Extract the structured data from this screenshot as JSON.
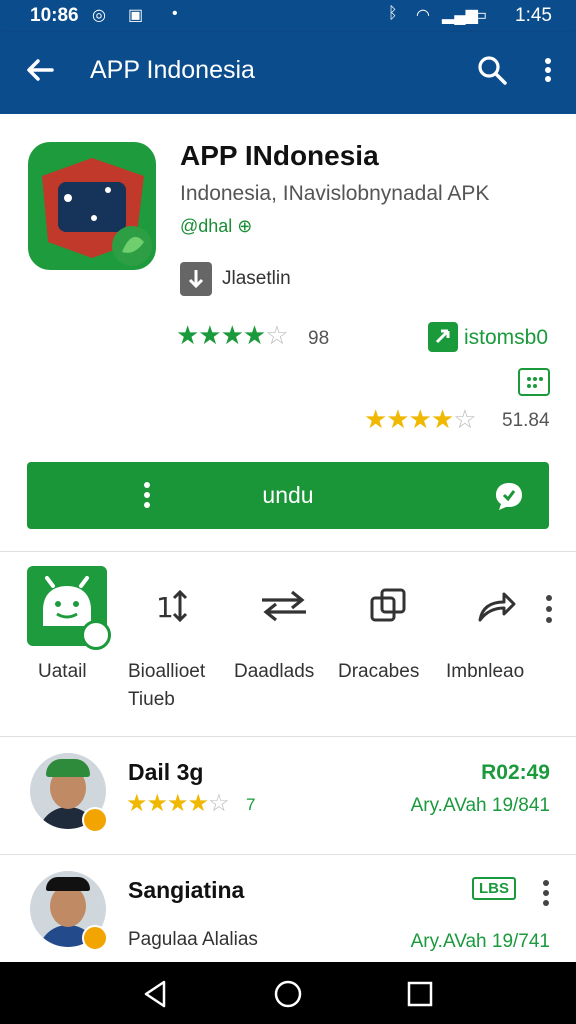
{
  "status": {
    "time_left": "10:86",
    "time_right": "1:45"
  },
  "appbar": {
    "title": "APP Indonesia"
  },
  "app": {
    "name": "APP INdonesia",
    "subtitle": "Indonesia, INavislobnynadal APK",
    "developer": "@dhal ⊕",
    "dev_label": "Jlasetlin",
    "rating1": {
      "stars": 4,
      "value": "98"
    },
    "install_label": "istomsb0",
    "rating2": {
      "stars": 4,
      "value": "51.84"
    },
    "install_button": "undu"
  },
  "actions": [
    {
      "label_1": "Uatail",
      "label_2": ""
    },
    {
      "label_1": "Bioallioet",
      "label_2": "Tiueb"
    },
    {
      "label_1": "Daadlads",
      "label_2": ""
    },
    {
      "label_1": "Dracabes",
      "label_2": ""
    },
    {
      "label_1": "Imbnleao",
      "label_2": ""
    }
  ],
  "reviews": [
    {
      "name": "Dail 3g",
      "date": "R02:49",
      "meta": "Ary.AVah 19/841",
      "stars": 4,
      "stars_value": "7"
    },
    {
      "name": "Sangiatina",
      "tag": "LBS",
      "text": "Pagulaa Alalias",
      "meta": "Ary.AVah 19/741"
    }
  ],
  "colors": {
    "appbar": "#0b4c8c",
    "green": "#1a9638",
    "gold": "#f0b800"
  },
  "icons": [
    "back-arrow-icon",
    "search-icon",
    "more-vert-icon",
    "compare-icon",
    "transfer-icon",
    "copy-icon",
    "share-icon",
    "chat-icon"
  ]
}
